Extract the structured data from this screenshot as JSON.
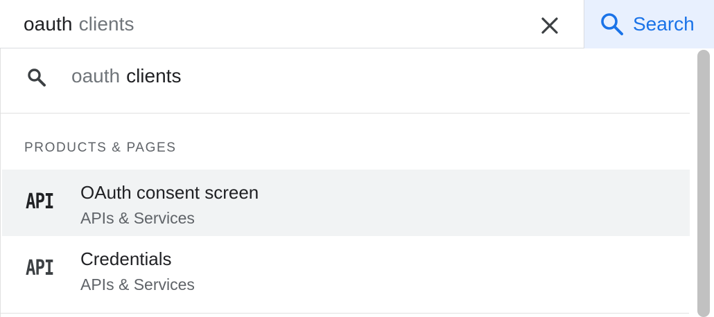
{
  "search": {
    "query_typed": "oauth",
    "query_autocomplete": "clients",
    "clear_icon": "close-icon",
    "button_label": "Search",
    "button_icon": "search-icon"
  },
  "suggestion": {
    "icon": "search-icon",
    "part1": "oauth",
    "part2": "clients"
  },
  "section": {
    "header": "PRODUCTS & PAGES"
  },
  "results": [
    {
      "icon_text": "API",
      "title": "OAuth consent screen",
      "subtitle": "APIs & Services",
      "highlighted": true
    },
    {
      "icon_text": "API",
      "title": "Credentials",
      "subtitle": "APIs & Services",
      "highlighted": false
    }
  ],
  "colors": {
    "accent": "#1a73e8",
    "search_button_bg": "#e8f0fe",
    "highlight_row": "#f1f3f4"
  }
}
